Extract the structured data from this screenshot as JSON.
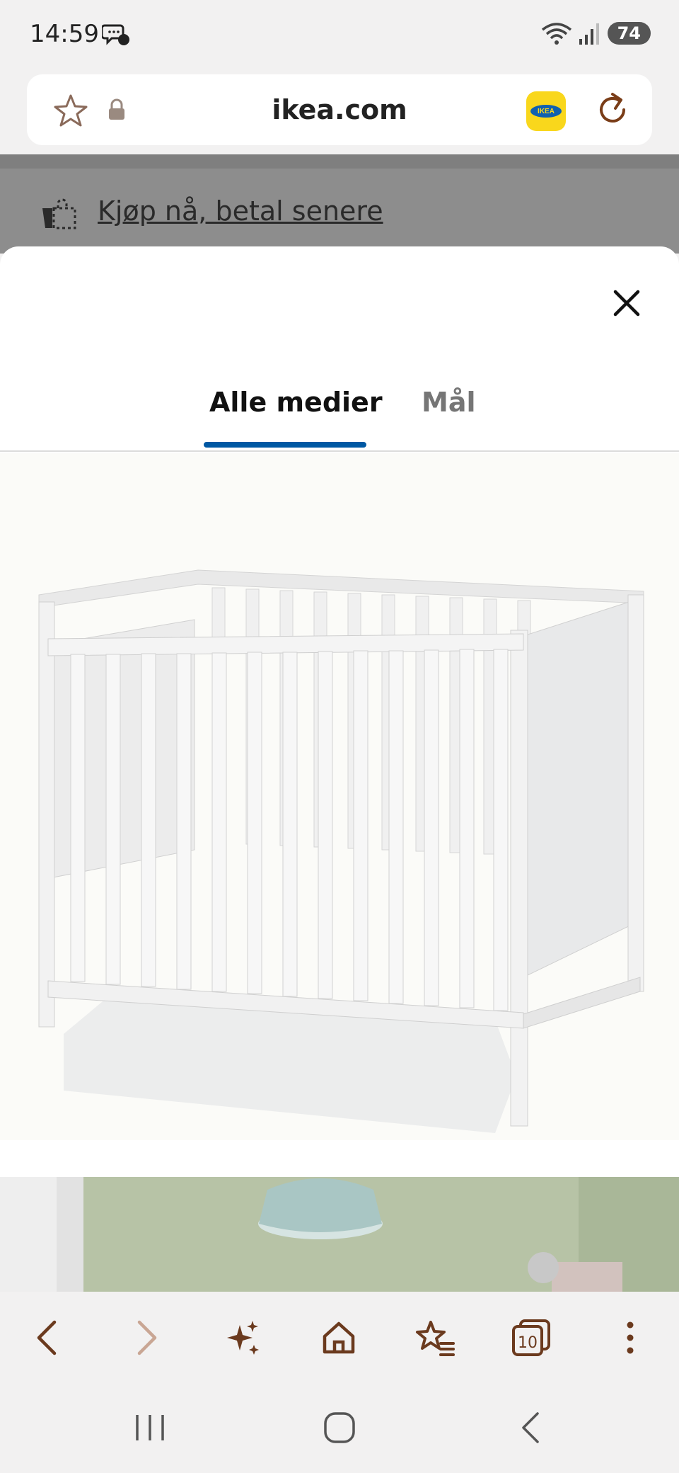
{
  "status_bar": {
    "time": "14:59",
    "battery": "74"
  },
  "browser": {
    "url": "ikea.com"
  },
  "page": {
    "promo_link": "Kjøp nå, betal senere"
  },
  "media_modal": {
    "tabs": [
      {
        "label": "Alle medier",
        "active": true
      },
      {
        "label": "Mål",
        "active": false
      }
    ]
  },
  "toolbar": {
    "tab_count": "10"
  },
  "colors": {
    "accent": "#0058a3",
    "icon_brown": "#6b3a1e",
    "ikea_yellow": "#f9d71c"
  }
}
